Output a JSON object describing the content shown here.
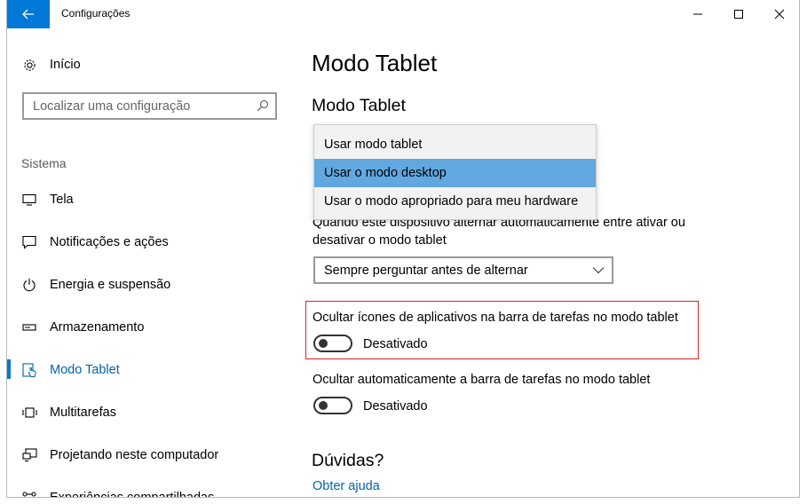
{
  "window": {
    "title": "Configurações"
  },
  "sidebar": {
    "home_label": "Início",
    "search_placeholder": "Localizar uma configuração",
    "section_label": "Sistema",
    "items": [
      {
        "label": "Tela",
        "icon": "monitor-icon"
      },
      {
        "label": "Notificações e ações",
        "icon": "notification-icon"
      },
      {
        "label": "Energia e suspensão",
        "icon": "power-icon"
      },
      {
        "label": "Armazenamento",
        "icon": "storage-icon"
      },
      {
        "label": "Modo Tablet",
        "icon": "tablet-mode-icon",
        "selected": true
      },
      {
        "label": "Multitarefas",
        "icon": "multitasking-icon"
      },
      {
        "label": "Projetando neste computador",
        "icon": "projecting-icon"
      },
      {
        "label": "Experiências compartilhadas",
        "icon": "shared-experiences-icon"
      }
    ]
  },
  "main": {
    "page_title": "Modo Tablet",
    "section_title": "Modo Tablet",
    "dropdown_options": [
      "Usar modo tablet",
      "Usar o modo desktop",
      "Usar o modo apropriado para meu hardware"
    ],
    "dropdown_selected": "Usar o modo desktop",
    "switch_description": "Quando este dispositivo alternar automaticamente entre ativar ou desativar o modo tablet",
    "switch_select_value": "Sempre perguntar antes de alternar",
    "hide_icons_label": "Ocultar ícones de aplicativos na barra de tarefas no modo tablet",
    "hide_icons_state": "Desativado",
    "hide_taskbar_label": "Ocultar automaticamente a barra de tarefas no modo tablet",
    "hide_taskbar_state": "Desativado",
    "help_title": "Dúvidas?",
    "help_link": "Obter ajuda"
  },
  "colors": {
    "accent": "#0078d7",
    "selected_text": "#0063b1",
    "dropdown_highlight": "#61a8e0",
    "highlight_border": "#e02020"
  }
}
